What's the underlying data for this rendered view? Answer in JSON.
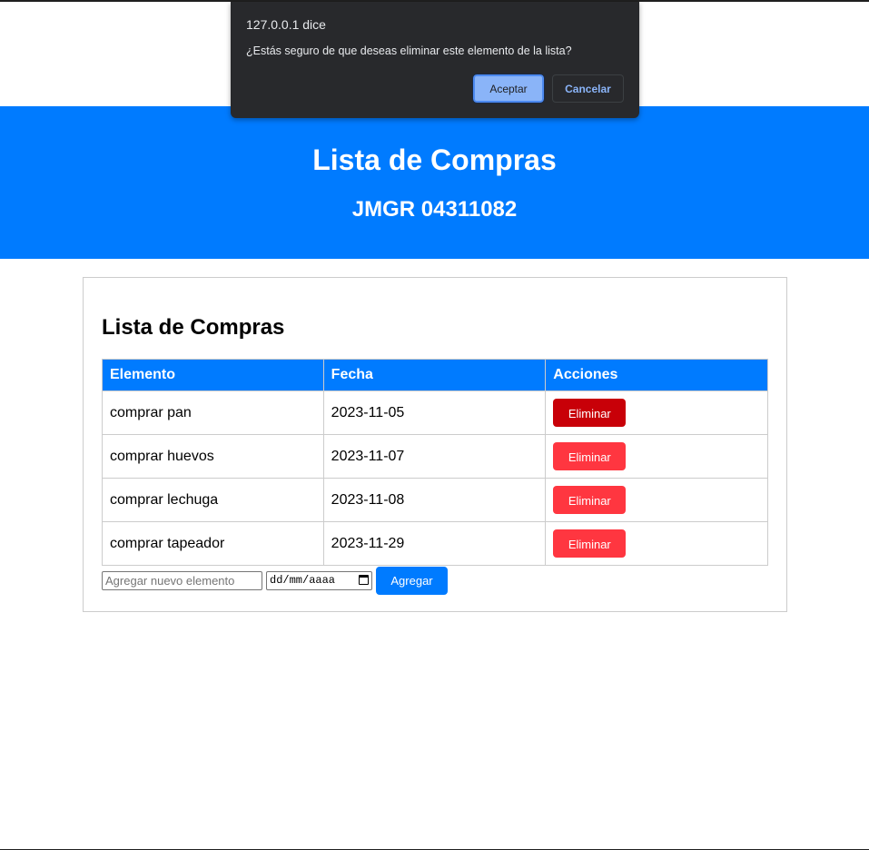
{
  "header": {
    "title": "Lista de Compras",
    "subtitle": "JMGR 04311082"
  },
  "list": {
    "title": "Lista de Compras",
    "columns": [
      "Elemento",
      "Fecha",
      "Acciones"
    ],
    "rows": [
      {
        "item": "comprar pan",
        "date": "2023-11-05",
        "action": "Eliminar",
        "pressed": true
      },
      {
        "item": "comprar huevos",
        "date": "2023-11-07",
        "action": "Eliminar",
        "pressed": false
      },
      {
        "item": "comprar lechuga",
        "date": "2023-11-08",
        "action": "Eliminar",
        "pressed": false
      },
      {
        "item": "comprar tapeador",
        "date": "2023-11-29",
        "action": "Eliminar",
        "pressed": false
      }
    ]
  },
  "add_form": {
    "item_placeholder": "Agregar nuevo elemento",
    "date_placeholder": "dd/mm/aaaa",
    "add_label": "Agregar"
  },
  "dialog": {
    "origin": "127.0.0.1 dice",
    "message": "¿Estás seguro de que deseas eliminar este elemento de la lista?",
    "accept_label": "Aceptar",
    "cancel_label": "Cancelar"
  },
  "colors": {
    "primary": "#007bff",
    "delete": "#ff3640",
    "delete_pressed": "#c80008",
    "dialog_bg": "#28292c",
    "dialog_accent": "#8ab4f8"
  },
  "icons": {
    "date_picker": "calendar-icon"
  }
}
